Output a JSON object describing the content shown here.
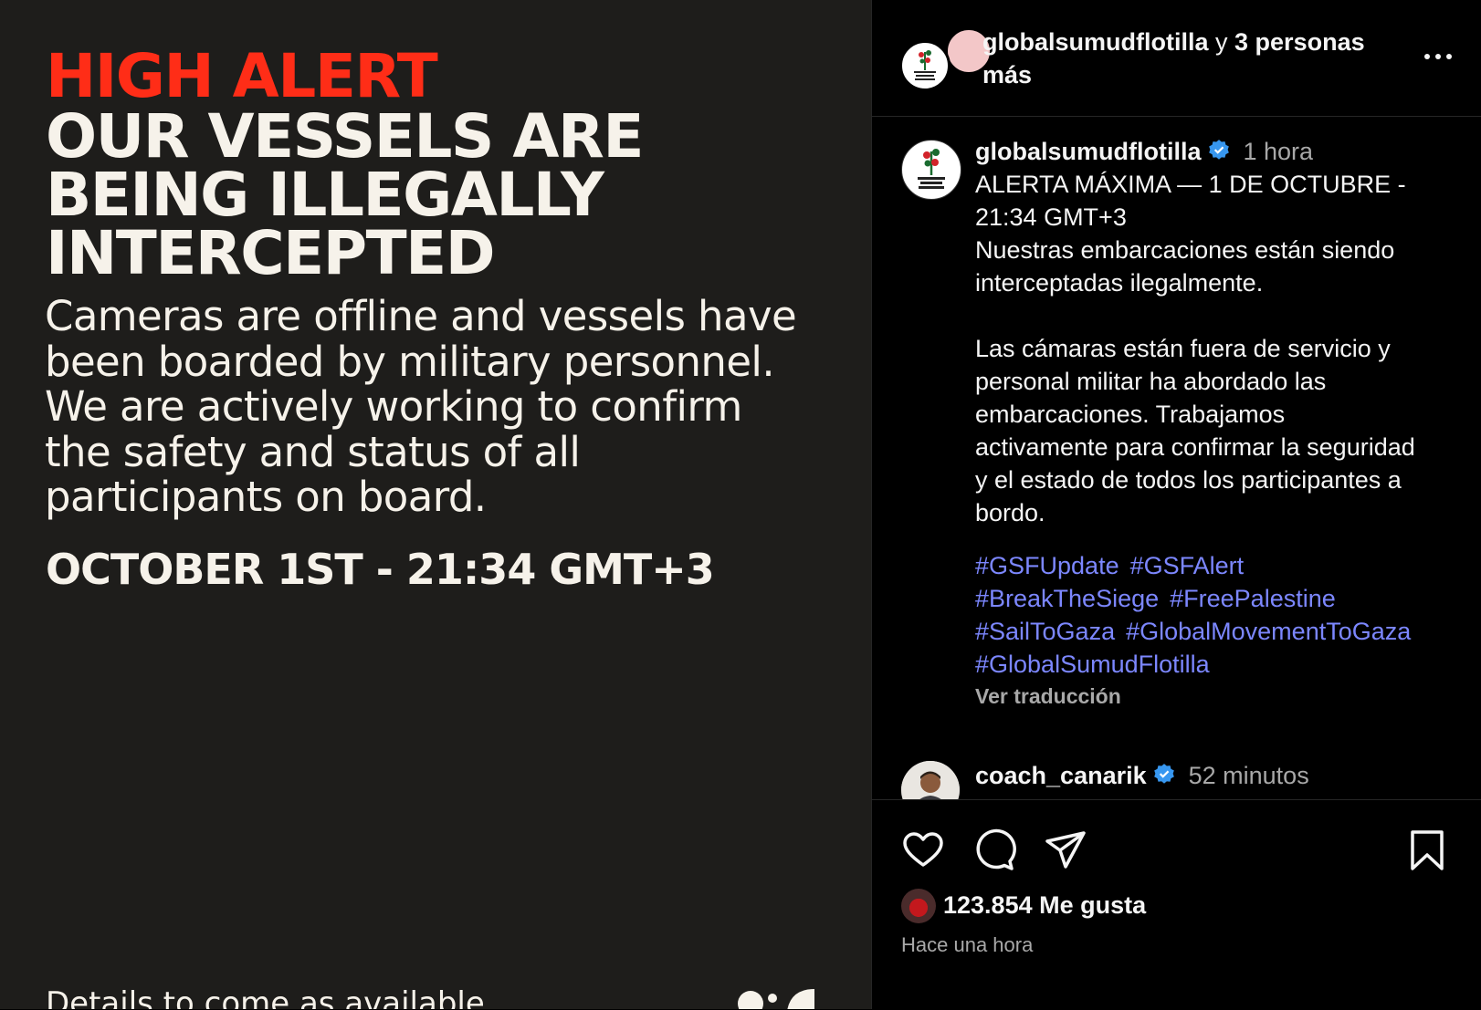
{
  "image_post": {
    "title": "HIGH ALERT",
    "headline_lines": [
      "OUR VESSELS ARE",
      "BEING ILLEGALLY",
      "INTERCEPTED"
    ],
    "body_lines": [
      "Cameras are offline and vessels have",
      "been boarded by military personnel.",
      "We are actively working to confirm",
      "the safety and status of all",
      "participants on board."
    ],
    "date": "OCTOBER 1ST - 21:34 GMT+3",
    "footer": "Details to come as available",
    "colors": {
      "background": "#1e1d1b",
      "alert": "#ff2d17",
      "text": "#f6f2ea"
    }
  },
  "header": {
    "username": "globalsumudflotilla",
    "connector": "y",
    "others": "3 personas",
    "others_cont": "más",
    "more_icon": "more-horizontal-icon"
  },
  "caption": {
    "username": "globalsumudflotilla",
    "verified": true,
    "time": "1 hora",
    "text": "ALERTA MÁXIMA — 1 DE OCTUBRE -\n21:34 GMT+3\nNuestras embarcaciones están siendo\ninterceptadas ilegalmente.\n\nLas cámaras están fuera de servicio y\npersonal militar ha abordado las\nembarcaciones. Trabajamos\nactivamente para confirmar la seguridad\ny el estado de todos los participantes a\nbordo.",
    "hashtags": [
      "#GSFUpdate",
      "#GSFAlert",
      "#BreakTheSiege",
      "#FreePalestine",
      "#SailToGaza",
      "#GlobalMovementToGaza",
      "#GlobalSumudFlotilla"
    ],
    "translate": "Ver traducción"
  },
  "comment": {
    "username": "coach_canarik",
    "verified": true,
    "time": "52 minutos"
  },
  "actions": {
    "icons": [
      "heart-icon",
      "comment-icon",
      "share-icon",
      "bookmark-icon"
    ],
    "likes": "123.854 Me gusta",
    "posted": "Hace una hora"
  },
  "colors": {
    "hashtag": "#7c87ff",
    "verified": "#3797f0",
    "muted": "#a8a8a8"
  }
}
